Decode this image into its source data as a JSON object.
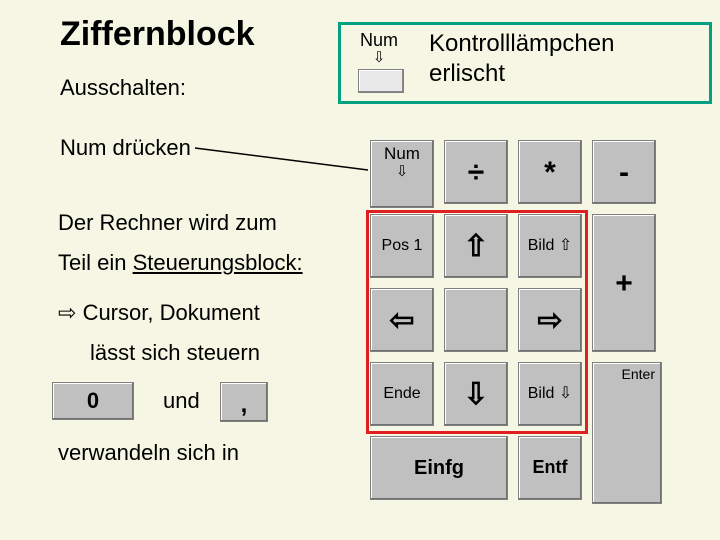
{
  "title": "Ziffernblock",
  "left": {
    "ausschalten": "Ausschalten:",
    "num_druecken": "Num drücken",
    "rechner_zum": "Der Rechner wird zum",
    "teil_ein": "Teil ein ",
    "steuerungsblock": "Steuerungsblock:",
    "cursor_doc": "Cursor, Dokument",
    "laesst": "lässt sich steuern",
    "und": "und",
    "verwandeln": "verwandeln sich in"
  },
  "deco": {
    "zero": "0",
    "comma": ","
  },
  "indicator": {
    "label": "Num",
    "arrow": "⇩",
    "message_line1": "Kontrolllämpchen",
    "message_line2": "erlischt"
  },
  "keys": {
    "num": "Num",
    "num_arrow": "⇩",
    "divide": "÷",
    "mult": "*",
    "minus": "-",
    "pos1": "Pos 1",
    "up": "⇧",
    "bild_up": "Bild ⇧",
    "plus": "+",
    "left": "⇦",
    "right": "⇨",
    "ende": "Ende",
    "down": "⇩",
    "bild_dn": "Bild ⇩",
    "einfg": "Einfg",
    "entf": "Entf",
    "enter": "Enter"
  },
  "arrow_glyph": "⇨"
}
